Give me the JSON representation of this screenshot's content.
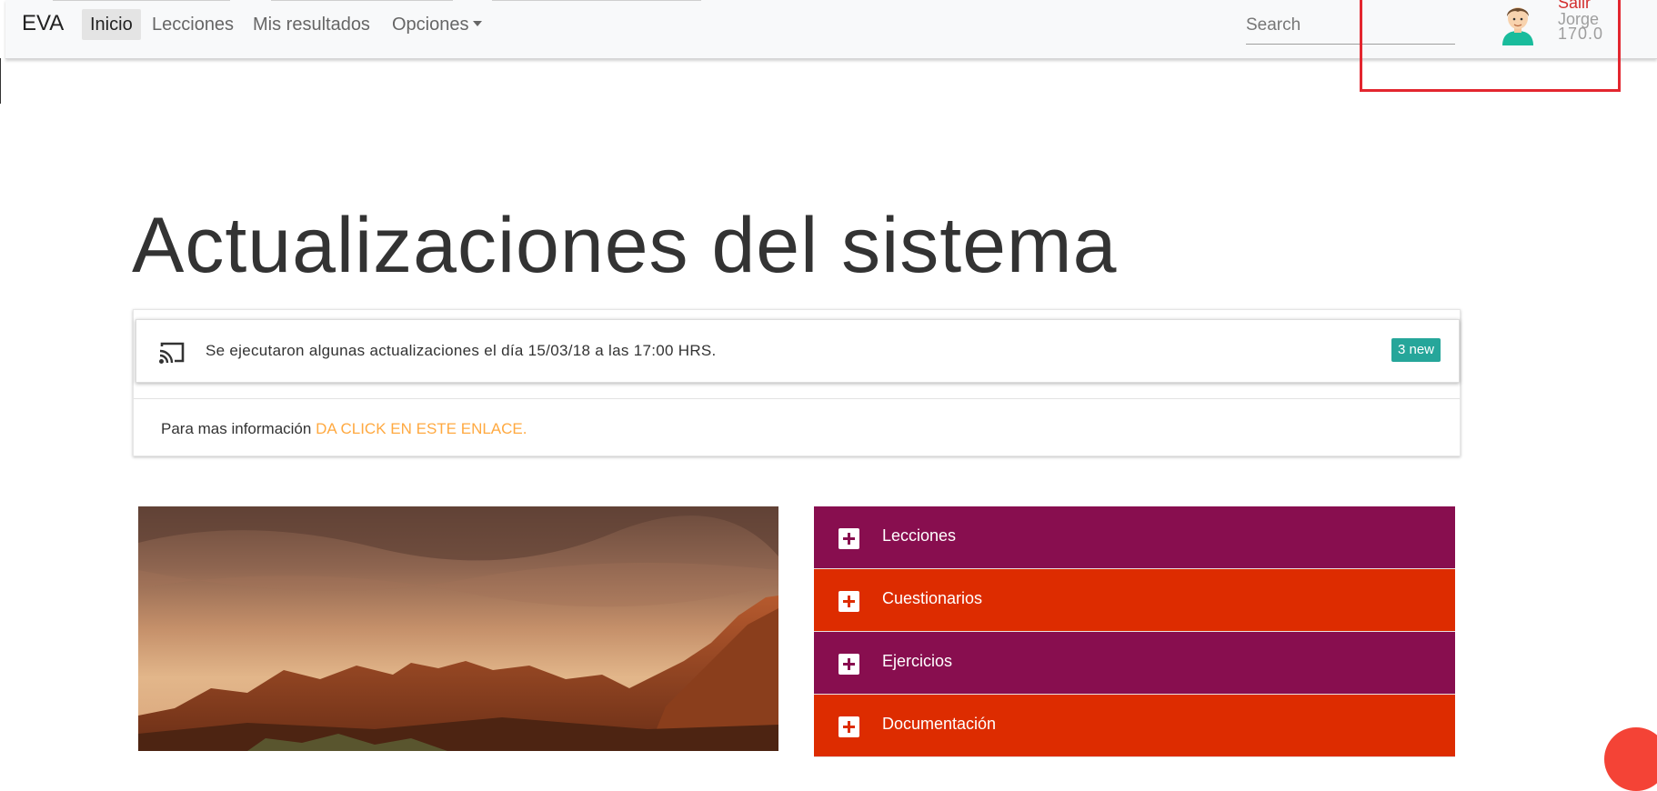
{
  "navbar": {
    "brand": "EVA",
    "items": [
      {
        "label": "Inicio",
        "active": true
      },
      {
        "label": "Lecciones",
        "active": false
      },
      {
        "label": "Mis resultados",
        "active": false
      },
      {
        "label": "Opciones",
        "active": false
      }
    ],
    "search_placeholder": "Search",
    "user": {
      "logout_label": "Salir",
      "name": "Jorge",
      "score": "170.0"
    }
  },
  "main": {
    "title": "Actualizaciones del sistema",
    "update_card": {
      "message": "Se ejecutaron algunas actualizaciones el día 15/03/18 a las 17:00 HRS.",
      "badge": "3 new",
      "info_prefix": "Para mas información",
      "info_link": "DA CLICK EN ESTE ENLACE."
    },
    "accordion": [
      {
        "label": "Lecciones",
        "color": "#880e4f"
      },
      {
        "label": "Cuestionarios",
        "color": "#dd2c00"
      },
      {
        "label": "Ejercicios",
        "color": "#880e4f"
      },
      {
        "label": "Documentación",
        "color": "#dd2c00"
      }
    ]
  },
  "colors": {
    "badge": "#26a69a",
    "link": "#ffa940",
    "logout": "#d32f2f",
    "highlight": "#e3262f"
  }
}
